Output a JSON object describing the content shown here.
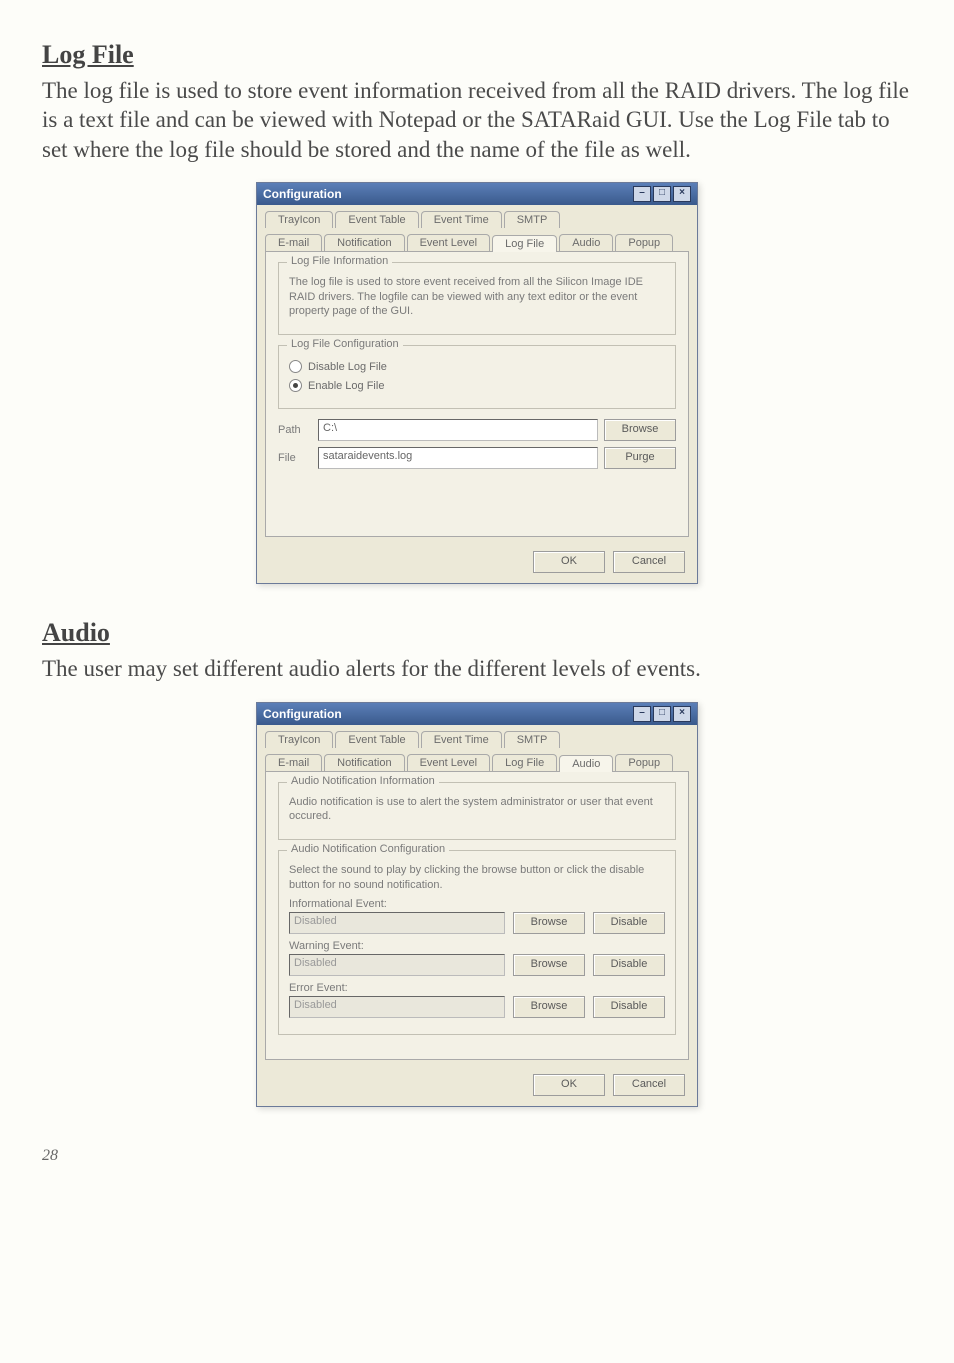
{
  "sections": {
    "logfile": {
      "heading": "Log File",
      "paragraph": "The log file is used to store event information received from all the RAID drivers. The log file is a text file and can be viewed with Notepad or the SATARaid GUI. Use the Log File tab to set where the log file should be stored and the name of the file as well."
    },
    "audio": {
      "heading": "Audio",
      "paragraph": "The user may set different audio alerts for the different levels of events."
    }
  },
  "dialog1": {
    "title": "Configuration",
    "tabs_row1": [
      "TrayIcon",
      "Event Table",
      "Event Time",
      "SMTP"
    ],
    "tabs_row2": [
      "E-mail",
      "Notification",
      "Event Level",
      "Log File",
      "Audio",
      "Popup"
    ],
    "active_tab": "Log File",
    "group_info_title": "Log File Information",
    "info_text": "The log file is used to store event received from all the Silicon Image IDE RAID drivers. The logfile can be viewed with any text editor or the event property page of the GUI.",
    "group_cfg_title": "Log File Configuration",
    "radio_disable": "Disable Log File",
    "radio_enable": "Enable Log File",
    "path_label": "Path",
    "path_value": "C:\\",
    "file_label": "File",
    "file_value": "sataraidevents.log",
    "browse_btn": "Browse",
    "purge_btn": "Purge",
    "ok": "OK",
    "cancel": "Cancel"
  },
  "dialog2": {
    "title": "Configuration",
    "tabs_row1": [
      "TrayIcon",
      "Event Table",
      "Event Time",
      "SMTP"
    ],
    "tabs_row2": [
      "E-mail",
      "Notification",
      "Event Level",
      "Log File",
      "Audio",
      "Popup"
    ],
    "active_tab": "Audio",
    "group_info_title": "Audio Notification Information",
    "info_text": "Audio notification is use to alert the system administrator or user that event occured.",
    "group_cfg_title": "Audio Notification Configuration",
    "cfg_text": "Select the sound to play by clicking the browse button or click the disable button for no sound notification.",
    "info_event_label": "Informational Event:",
    "info_event_value": "Disabled",
    "warn_event_label": "Warning Event:",
    "warn_event_value": "Disabled",
    "error_event_label": "Error Event:",
    "error_event_value": "Disabled",
    "browse_btn": "Browse",
    "disable_btn": "Disable",
    "ok": "OK",
    "cancel": "Cancel"
  },
  "page_number": "28"
}
